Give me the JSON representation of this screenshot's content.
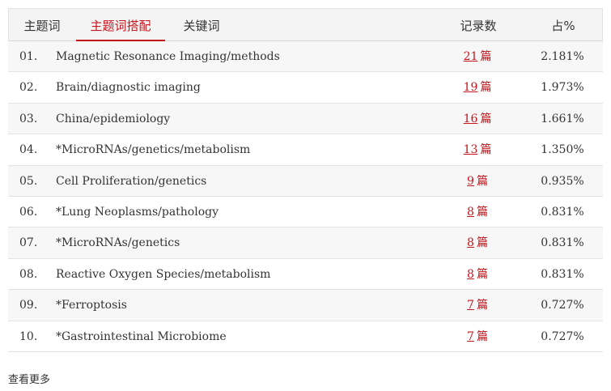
{
  "tabs": [
    {
      "label": "主题词",
      "active": false
    },
    {
      "label": "主题词搭配",
      "active": true
    },
    {
      "label": "关键词",
      "active": false
    }
  ],
  "columns": {
    "count": "记录数",
    "percent": "占%"
  },
  "unit_label": "篇",
  "rows": [
    {
      "index": "01.",
      "term": "Magnetic Resonance Imaging/methods",
      "count": "21",
      "percent": "2.181%"
    },
    {
      "index": "02.",
      "term": "Brain/diagnostic imaging",
      "count": "19",
      "percent": "1.973%"
    },
    {
      "index": "03.",
      "term": "China/epidemiology",
      "count": "16",
      "percent": "1.661%"
    },
    {
      "index": "04.",
      "term": "*MicroRNAs/genetics/metabolism",
      "count": "13",
      "percent": "1.350%"
    },
    {
      "index": "05.",
      "term": "Cell Proliferation/genetics",
      "count": "9",
      "percent": "0.935%"
    },
    {
      "index": "06.",
      "term": "*Lung Neoplasms/pathology",
      "count": "8",
      "percent": "0.831%"
    },
    {
      "index": "07.",
      "term": "*MicroRNAs/genetics",
      "count": "8",
      "percent": "0.831%"
    },
    {
      "index": "08.",
      "term": "Reactive Oxygen Species/metabolism",
      "count": "8",
      "percent": "0.831%"
    },
    {
      "index": "09.",
      "term": "*Ferroptosis",
      "count": "7",
      "percent": "0.727%"
    },
    {
      "index": "10.",
      "term": "*Gastrointestinal Microbiome",
      "count": "7",
      "percent": "0.727%"
    }
  ],
  "more_label": "查看更多",
  "colors": {
    "accent": "#c4161c",
    "row_alt": "#f7f7f7",
    "header_bg": "#f4f4f4"
  }
}
